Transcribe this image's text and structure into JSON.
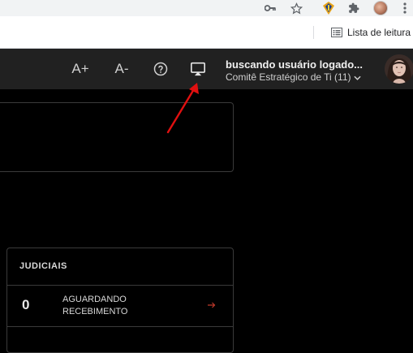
{
  "browser": {
    "reading_list_label": "Lista de leitura",
    "icons": [
      "key-icon",
      "star-icon",
      "extension-icon",
      "puzzle-icon",
      "profile-avatar",
      "kebab-menu-icon"
    ]
  },
  "header": {
    "font_increase_label": "A+",
    "font_decrease_label": "A-",
    "help_icon": "question-circle-icon",
    "cast_icon": "cast-screen-icon",
    "user_name": "buscando usuário logado...",
    "committee": "Comitê Estratégico de Ti (11)"
  },
  "cards": {
    "judiciais": {
      "title": "JUDICIAIS",
      "rows": [
        {
          "count": "0",
          "label": "AGUARDANDO RECEBIMENTO"
        }
      ]
    }
  },
  "colors": {
    "header_bg": "#212121",
    "page_bg": "#000000",
    "accent_arrow": "#c0392b",
    "annotation": "#e01010"
  }
}
